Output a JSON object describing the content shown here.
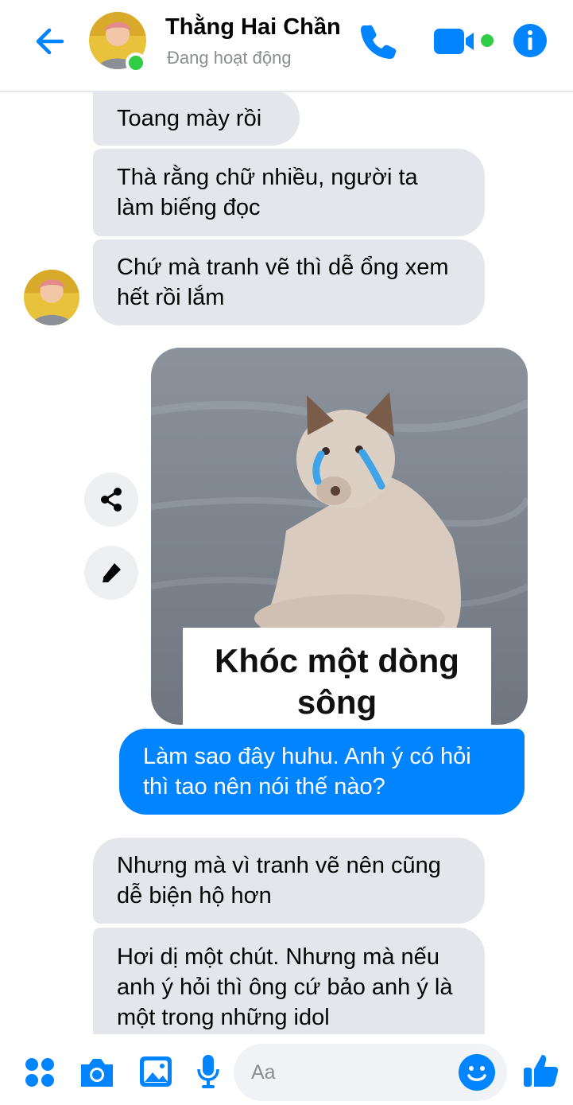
{
  "header": {
    "contact_name": "Thằng Hai Chần",
    "status": "Đang hoạt động"
  },
  "messages": [
    {
      "side": "incoming",
      "text": "Toang mày rồi"
    },
    {
      "side": "incoming",
      "text": "Thà rằng chữ nhiều, người ta làm biếng đọc"
    },
    {
      "side": "incoming",
      "text": "Chứ mà tranh vẽ thì dễ ổng xem hết rồi lắm"
    },
    {
      "side": "outgoing",
      "type": "image",
      "caption": "Khóc một dòng sông"
    },
    {
      "side": "outgoing",
      "text": "Làm sao đây huhu. Anh ý có hỏi thì tao nên nói thế nào?"
    },
    {
      "side": "incoming",
      "text": "Nhưng mà vì tranh vẽ nên cũng dễ biện hộ hơn"
    },
    {
      "side": "incoming",
      "text": "Hơi dị một chút. Nhưng mà nếu anh ý hỏi thì ông cứ bảo anh ý là một trong những idol"
    }
  ],
  "composer": {
    "placeholder": "Aa"
  },
  "colors": {
    "accent": "#0084ff",
    "incoming_bubble": "#e4e6eb",
    "online": "#31cc46"
  },
  "icons": [
    "back-arrow-icon",
    "phone-icon",
    "video-icon",
    "info-icon",
    "share-icon",
    "pencil-icon",
    "menu-dots-icon",
    "camera-icon",
    "image-icon",
    "microphone-icon",
    "emoji-icon",
    "thumbs-up-icon"
  ]
}
